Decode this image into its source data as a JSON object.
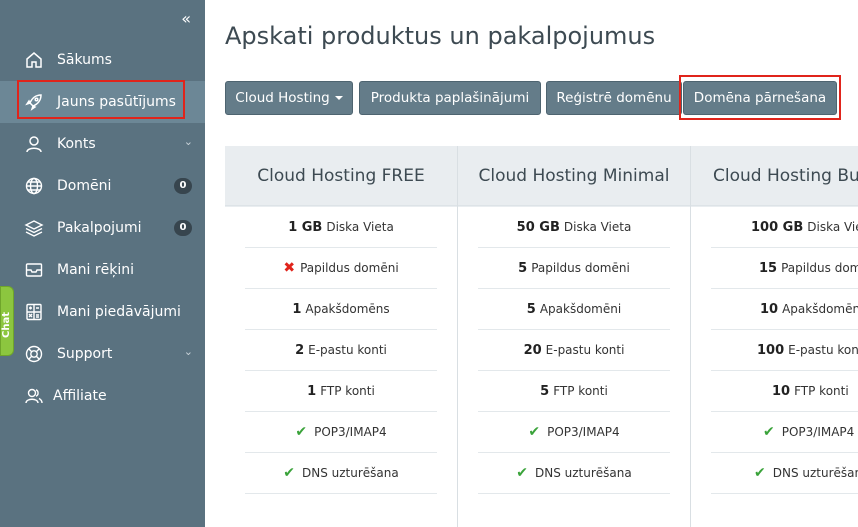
{
  "sidebar": {
    "collapse_icon": "double-chevron-left-icon",
    "items": [
      {
        "label": "Sākums",
        "icon": "home-icon"
      },
      {
        "label": "Jauns pasūtījums",
        "icon": "rocket-icon",
        "active": true
      },
      {
        "label": "Konts",
        "icon": "user-icon",
        "expandable": true
      },
      {
        "label": "Domēni",
        "icon": "globe-icon",
        "badge": "0"
      },
      {
        "label": "Pakalpojumi",
        "icon": "layers-icon",
        "badge": "0"
      },
      {
        "label": "Mani rēķini",
        "icon": "inbox-icon"
      },
      {
        "label": "Mani piedāvājumi",
        "icon": "calculator-icon"
      },
      {
        "label": "Support",
        "icon": "lifebuoy-icon",
        "expandable": true
      },
      {
        "label": "Affiliate",
        "icon": "users-icon"
      }
    ]
  },
  "chat_tab": {
    "label": "Chat"
  },
  "main": {
    "title": "Apskati produktus un pakalpojumus",
    "buttons": [
      {
        "label": "Cloud Hosting",
        "dropdown": true
      },
      {
        "label": "Produkta paplašinājumi"
      },
      {
        "label": "Reģistrē domēnu"
      },
      {
        "label": "Domēna pārnešana"
      }
    ]
  },
  "plans": [
    {
      "name": "Cloud Hosting FREE",
      "features": [
        {
          "value": "1 GB",
          "label": "Diska Vieta"
        },
        {
          "icon": "cross-icon",
          "label": "Papildus domēni"
        },
        {
          "value": "1",
          "label": "Apakšdomēns"
        },
        {
          "value": "2",
          "label": "E-pastu konti"
        },
        {
          "value": "1",
          "label": "FTP konti"
        },
        {
          "icon": "check-icon",
          "label": "POP3/IMAP4"
        },
        {
          "icon": "check-icon",
          "label": "DNS uzturēšana"
        }
      ]
    },
    {
      "name": "Cloud Hosting Minimal",
      "features": [
        {
          "value": "50 GB",
          "label": "Diska Vieta"
        },
        {
          "value": "5",
          "label": "Papildus domēni"
        },
        {
          "value": "5",
          "label": "Apakšdomēni"
        },
        {
          "value": "20",
          "label": "E-pastu konti"
        },
        {
          "value": "5",
          "label": "FTP konti"
        },
        {
          "icon": "check-icon",
          "label": "POP3/IMAP4"
        },
        {
          "icon": "check-icon",
          "label": "DNS uzturēšana"
        }
      ]
    },
    {
      "name": "Cloud Hosting Bus",
      "features": [
        {
          "value": "100 GB",
          "label": "Diska Vieta"
        },
        {
          "value": "15",
          "label": "Papildus domēni"
        },
        {
          "value": "10",
          "label": "Apakšdomēni"
        },
        {
          "value": "100",
          "label": "E-pastu konti"
        },
        {
          "value": "10",
          "label": "FTP konti"
        },
        {
          "icon": "check-icon",
          "label": "POP3/IMAP4"
        },
        {
          "icon": "check-icon",
          "label": "DNS uzturēšana"
        }
      ]
    }
  ],
  "colors": {
    "sidebar": "#5a7280",
    "sidebar_active": "#6c8796",
    "button": "#647c89",
    "highlight": "#e0241b",
    "check": "#3aa33a",
    "cross": "#e0241b"
  }
}
